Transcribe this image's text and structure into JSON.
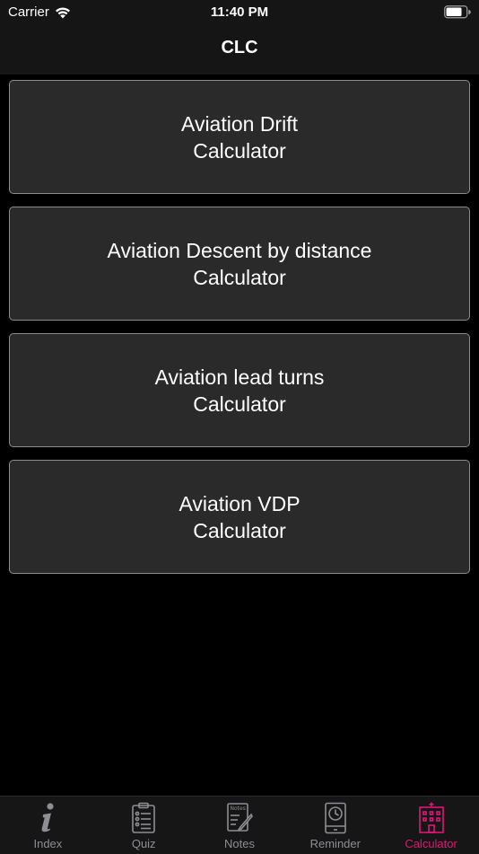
{
  "status_bar": {
    "carrier": "Carrier",
    "time": "11:40 PM",
    "icons": [
      "wifi-icon",
      "battery-icon"
    ]
  },
  "nav": {
    "title": "CLC"
  },
  "menu": {
    "items": [
      {
        "line1": "Aviation Drift",
        "line2": "Calculator"
      },
      {
        "line1": "Aviation Descent by distance",
        "line2": "Calculator"
      },
      {
        "line1": "Aviation lead turns",
        "line2": "Calculator"
      },
      {
        "line1": "Aviation VDP",
        "line2": "Calculator"
      }
    ]
  },
  "tab_bar": {
    "tabs": [
      {
        "label": "Index",
        "icon": "info-icon"
      },
      {
        "label": "Quiz",
        "icon": "clipboard-checklist-icon"
      },
      {
        "label": "Notes",
        "icon": "notes-pencil-icon"
      },
      {
        "label": "Reminder",
        "icon": "phone-clock-icon"
      },
      {
        "label": "Calculator",
        "icon": "building-icon",
        "active": true
      }
    ],
    "notes_icon_text": "Notes"
  },
  "colors": {
    "accent": "#e0157a",
    "inactive": "#8e8e93",
    "button_bg": "#2a2a2a",
    "button_border": "#8c8c8c",
    "bar_bg": "#151515"
  }
}
